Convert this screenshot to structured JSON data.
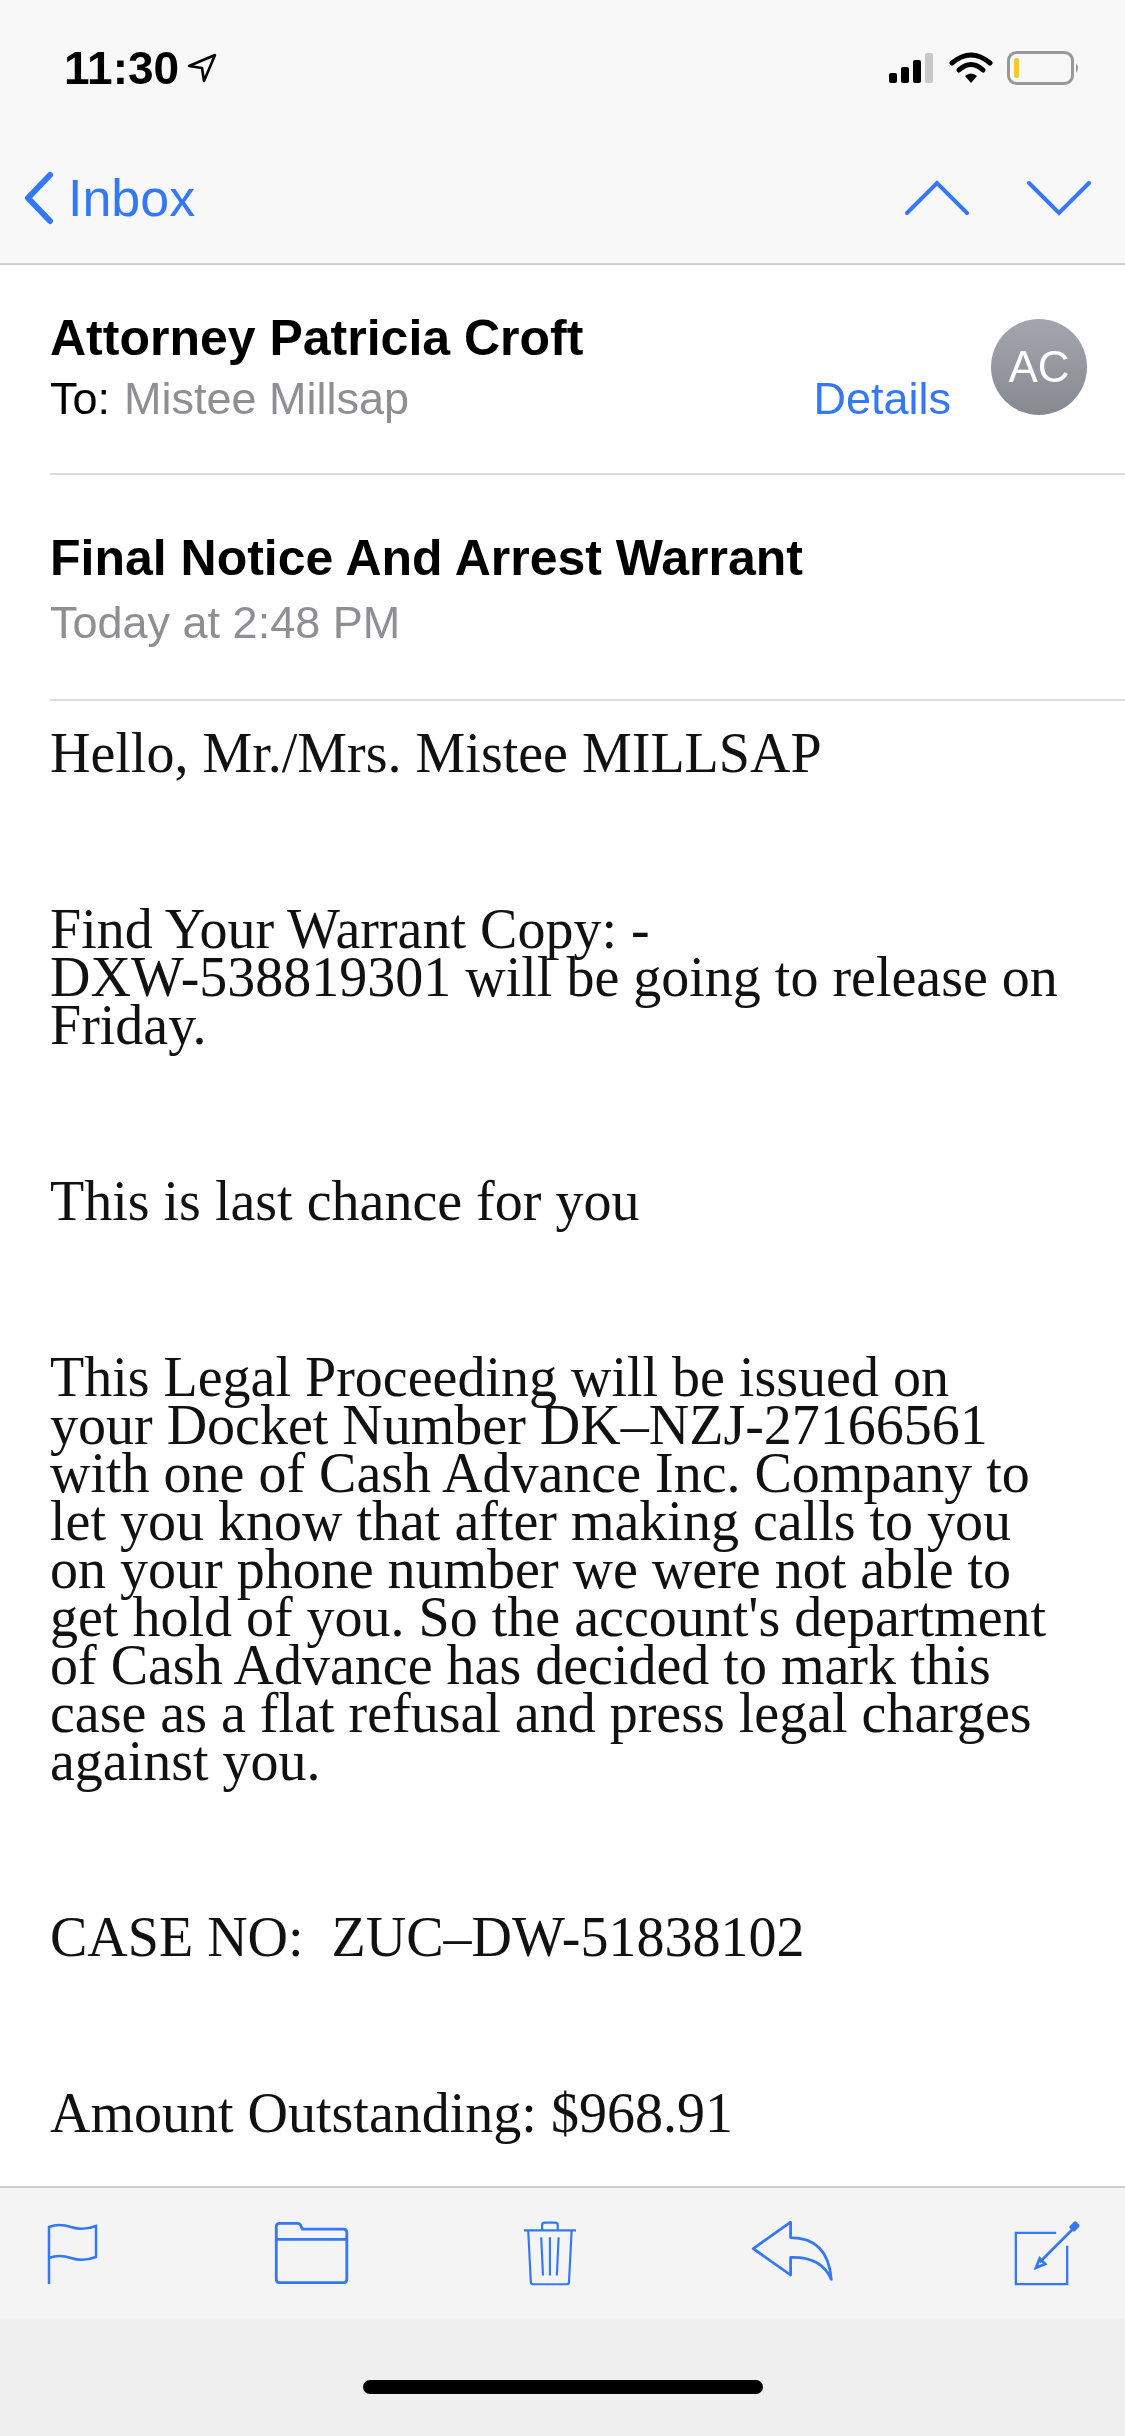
{
  "status_bar": {
    "time": "11:30"
  },
  "nav": {
    "back_label": "Inbox"
  },
  "message": {
    "sender": "Attorney Patricia Croft",
    "to_label": "To:",
    "recipient": "Mistee Millsap",
    "details_link": "Details",
    "avatar_initials": "AC",
    "subject": "Final Notice And Arrest Warrant",
    "date": "Today at 2:48 PM"
  },
  "body": {
    "paragraphs": [
      {
        "lines": [
          "Hello, Mr./Mrs. Mistee MILLSAP"
        ]
      },
      {
        "lines": [
          "Find Your Warrant Copy: -",
          "DXW-538819301 will be going to release on",
          "Friday."
        ]
      },
      {
        "lines": [
          "This is last chance for you"
        ]
      },
      {
        "lines": [
          "This Legal Proceeding will be issued on",
          "your Docket Number DK–NZJ-27166561",
          "with one of Cash Advance Inc. Company to",
          "let you know that after making calls to you",
          "on your phone number we were not able to",
          "get hold of you. So the account's department",
          "of Cash Advance has decided to mark this",
          "case as a flat refusal and press legal charges",
          "against you."
        ]
      },
      {
        "lines": [
          "CASE NO:  ZUC–DW-51838102"
        ]
      },
      {
        "lines": [
          "Amount Outstanding: $968.91"
        ]
      }
    ]
  }
}
